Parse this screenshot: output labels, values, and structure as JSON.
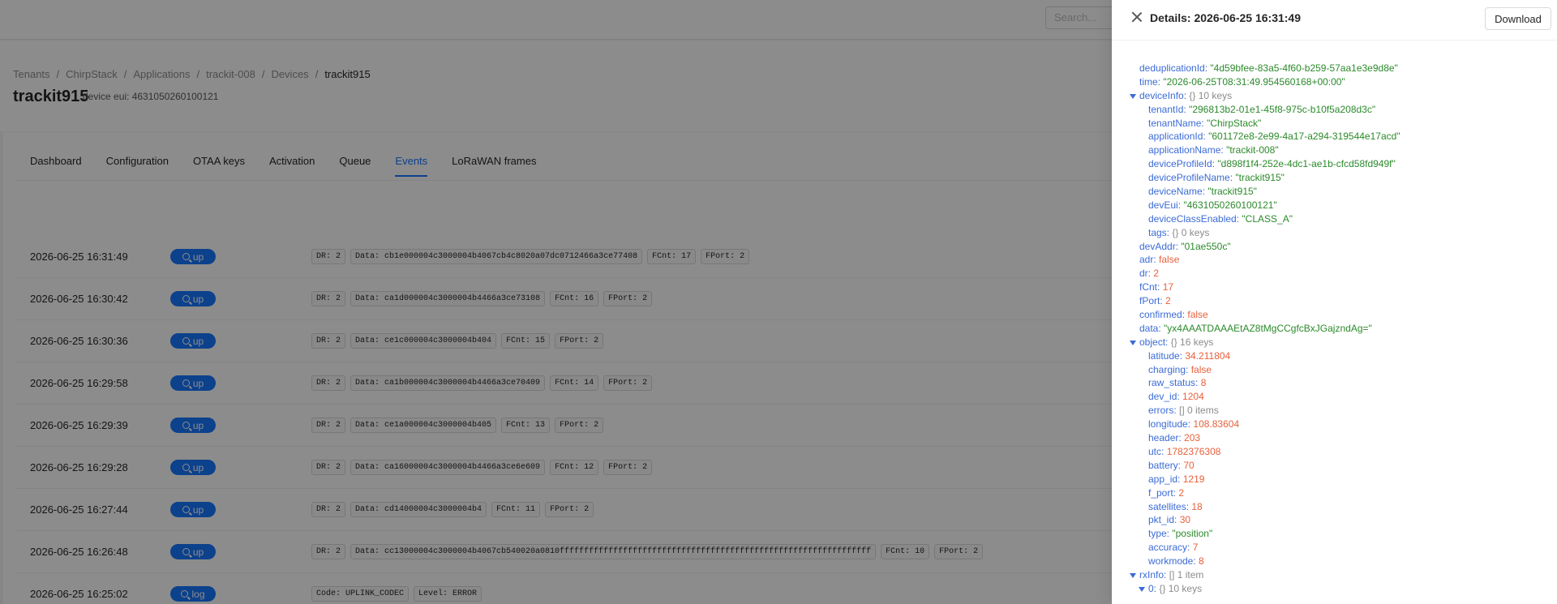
{
  "search": {
    "placeholder": "Search..."
  },
  "breadcrumb": [
    "Tenants",
    "ChirpStack",
    "Applications",
    "trackit-008",
    "Devices",
    "trackit915"
  ],
  "device": {
    "title": "trackit915",
    "subtitle": "device eui: 4631050260100121"
  },
  "tabs": [
    {
      "label": "Dashboard",
      "active": false
    },
    {
      "label": "Configuration",
      "active": false
    },
    {
      "label": "OTAA keys",
      "active": false
    },
    {
      "label": "Activation",
      "active": false
    },
    {
      "label": "Queue",
      "active": false
    },
    {
      "label": "Events",
      "active": true
    },
    {
      "label": "LoRaWAN frames",
      "active": false
    }
  ],
  "events": [
    {
      "time": "2026-06-25 16:31:49",
      "type": "up",
      "tags": [
        "DR: 2",
        "Data: cb1e000004c3000004b4067cb4c8020a07dc0712466a3ce77408",
        "FCnt: 17",
        "FPort: 2"
      ]
    },
    {
      "time": "2026-06-25 16:30:42",
      "type": "up",
      "tags": [
        "DR: 2",
        "Data: ca1d000004c3000004b4466a3ce73108",
        "FCnt: 16",
        "FPort: 2"
      ]
    },
    {
      "time": "2026-06-25 16:30:36",
      "type": "up",
      "tags": [
        "DR: 2",
        "Data: ce1c000004c3000004b404",
        "FCnt: 15",
        "FPort: 2"
      ]
    },
    {
      "time": "2026-06-25 16:29:58",
      "type": "up",
      "tags": [
        "DR: 2",
        "Data: ca1b000004c3000004b4466a3ce70409",
        "FCnt: 14",
        "FPort: 2"
      ]
    },
    {
      "time": "2026-06-25 16:29:39",
      "type": "up",
      "tags": [
        "DR: 2",
        "Data: ce1a000004c3000004b405",
        "FCnt: 13",
        "FPort: 2"
      ]
    },
    {
      "time": "2026-06-25 16:29:28",
      "type": "up",
      "tags": [
        "DR: 2",
        "Data: ca16000004c3000004b4466a3ce6e609",
        "FCnt: 12",
        "FPort: 2"
      ]
    },
    {
      "time": "2026-06-25 16:27:44",
      "type": "up",
      "tags": [
        "DR: 2",
        "Data: cd14000004c3000004b4",
        "FCnt: 11",
        "FPort: 2"
      ]
    },
    {
      "time": "2026-06-25 16:26:48",
      "type": "up",
      "tags": [
        "DR: 2",
        "Data: cc13000004c3000004b4067cb540020a0810ffffffffffffffffffffffffffffffffffffffffffffffffffffffffffffffff",
        "FCnt: 10",
        "FPort: 2"
      ]
    },
    {
      "time": "2026-06-25 16:25:02",
      "type": "log",
      "tags": [
        "Code: UPLINK_CODEC",
        "Level: ERROR"
      ]
    }
  ],
  "drawer": {
    "title": "Details: 2026-06-25 16:31:49",
    "download_label": "Download",
    "lines": [
      {
        "indent": 0,
        "key": "deduplicationId:",
        "val": "\"4d59bfee-83a5-4f60-b259-57aa1e3e9d8e\"",
        "kind": "s"
      },
      {
        "indent": 0,
        "key": "time:",
        "val": "\"2026-06-25T08:31:49.954560168+00:00\"",
        "kind": "s"
      },
      {
        "indent": 0,
        "key": "deviceInfo:",
        "val": "{}  10 keys",
        "kind": "m",
        "toggle": true
      },
      {
        "indent": 1,
        "key": "tenantId:",
        "val": "\"296813b2-01e1-45f8-975c-b10f5a208d3c\"",
        "kind": "s"
      },
      {
        "indent": 1,
        "key": "tenantName:",
        "val": "\"ChirpStack\"",
        "kind": "s"
      },
      {
        "indent": 1,
        "key": "applicationId:",
        "val": "\"601172e8-2e99-4a17-a294-319544e17acd\"",
        "kind": "s"
      },
      {
        "indent": 1,
        "key": "applicationName:",
        "val": "\"trackit-008\"",
        "kind": "s"
      },
      {
        "indent": 1,
        "key": "deviceProfileId:",
        "val": "\"d898f1f4-252e-4dc1-ae1b-cfcd58fd949f\"",
        "kind": "s"
      },
      {
        "indent": 1,
        "key": "deviceProfileName:",
        "val": "\"trackit915\"",
        "kind": "s"
      },
      {
        "indent": 1,
        "key": "deviceName:",
        "val": "\"trackit915\"",
        "kind": "s"
      },
      {
        "indent": 1,
        "key": "devEui:",
        "val": "\"4631050260100121\"",
        "kind": "s"
      },
      {
        "indent": 1,
        "key": "deviceClassEnabled:",
        "val": "\"CLASS_A\"",
        "kind": "s"
      },
      {
        "indent": 1,
        "key": "tags:",
        "val": "{}  0 keys",
        "kind": "m"
      },
      {
        "indent": 0,
        "key": "devAddr:",
        "val": "\"01ae550c\"",
        "kind": "s"
      },
      {
        "indent": 0,
        "key": "adr:",
        "val": "false",
        "kind": "b"
      },
      {
        "indent": 0,
        "key": "dr:",
        "val": "2",
        "kind": "n"
      },
      {
        "indent": 0,
        "key": "fCnt:",
        "val": "17",
        "kind": "n"
      },
      {
        "indent": 0,
        "key": "fPort:",
        "val": "2",
        "kind": "n"
      },
      {
        "indent": 0,
        "key": "confirmed:",
        "val": "false",
        "kind": "b"
      },
      {
        "indent": 0,
        "key": "data:",
        "val": "\"yx4AAATDAAAEtAZ8tMgCCgfcBxJGajzndAg=\"",
        "kind": "s"
      },
      {
        "indent": 0,
        "key": "object:",
        "val": "{}  16 keys",
        "kind": "m",
        "toggle": true
      },
      {
        "indent": 1,
        "key": "latitude:",
        "val": "34.211804",
        "kind": "n"
      },
      {
        "indent": 1,
        "key": "charging:",
        "val": "false",
        "kind": "b"
      },
      {
        "indent": 1,
        "key": "raw_status:",
        "val": "8",
        "kind": "n"
      },
      {
        "indent": 1,
        "key": "dev_id:",
        "val": "1204",
        "kind": "n"
      },
      {
        "indent": 1,
        "key": "errors:",
        "val": "[]  0 items",
        "kind": "m"
      },
      {
        "indent": 1,
        "key": "longitude:",
        "val": "108.83604",
        "kind": "n"
      },
      {
        "indent": 1,
        "key": "header:",
        "val": "203",
        "kind": "n"
      },
      {
        "indent": 1,
        "key": "utc:",
        "val": "1782376308",
        "kind": "n"
      },
      {
        "indent": 1,
        "key": "battery:",
        "val": "70",
        "kind": "n"
      },
      {
        "indent": 1,
        "key": "app_id:",
        "val": "1219",
        "kind": "n"
      },
      {
        "indent": 1,
        "key": "f_port:",
        "val": "2",
        "kind": "n"
      },
      {
        "indent": 1,
        "key": "satellites:",
        "val": "18",
        "kind": "n"
      },
      {
        "indent": 1,
        "key": "pkt_id:",
        "val": "30",
        "kind": "n"
      },
      {
        "indent": 1,
        "key": "type:",
        "val": "\"position\"",
        "kind": "s"
      },
      {
        "indent": 1,
        "key": "accuracy:",
        "val": "7",
        "kind": "n"
      },
      {
        "indent": 1,
        "key": "workmode:",
        "val": "8",
        "kind": "n"
      },
      {
        "indent": 0,
        "key": "rxInfo:",
        "val": "[]  1 item",
        "kind": "m",
        "toggle": true
      },
      {
        "indent": 1,
        "key": "0:",
        "val": "{}  10 keys",
        "kind": "m",
        "toggle": true
      }
    ]
  }
}
